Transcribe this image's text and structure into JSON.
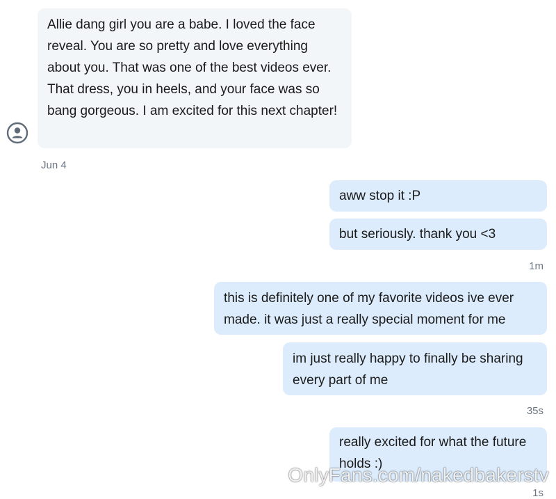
{
  "conversation": {
    "incoming": [
      {
        "text": "Allie dang girl you are a babe. I loved the face reveal. You are so pretty and love everything about you. That was one of the best videos ever. That dress, you in heels, and your face was so bang gorgeous. I am excited for this next chapter!"
      }
    ],
    "date_label": "Jun 4",
    "outgoing": [
      {
        "text": "aww stop it :P"
      },
      {
        "text": "but seriously. thank you <3"
      },
      {
        "text": "this is definitely one of my favorite videos ive ever made. it was just a really special moment for me"
      },
      {
        "text": "im just really happy to finally be sharing every part of me"
      },
      {
        "text": "really excited for what the future holds :)"
      }
    ],
    "timestamps": [
      "1m",
      "35s",
      "1s"
    ]
  },
  "watermark": "OnlyFans.com/nakedbakerstv",
  "icons": {
    "avatar": "user-avatar-icon"
  },
  "colors": {
    "incoming_bubble": "#f3f6f9",
    "outgoing_bubble": "#dcecfc",
    "timestamp": "#6b7580",
    "avatar_stroke": "#5f6b76"
  }
}
